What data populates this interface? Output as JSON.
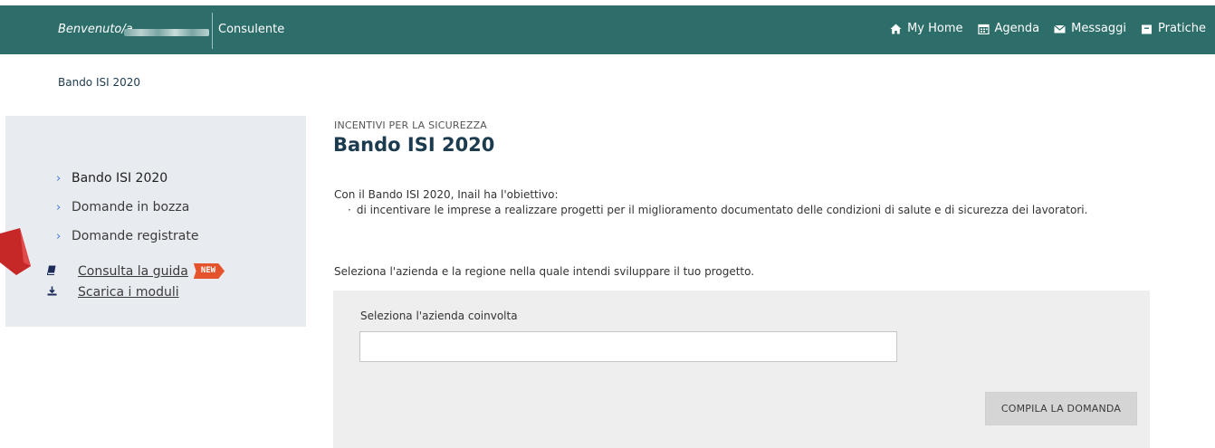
{
  "header": {
    "welcome": "Benvenuto/a",
    "role": "Consulente",
    "nav": [
      {
        "label": "My Home",
        "icon": "home-icon"
      },
      {
        "label": "Agenda",
        "icon": "calendar-icon"
      },
      {
        "label": "Messaggi",
        "icon": "envelope-icon"
      },
      {
        "label": "Pratiche",
        "icon": "folder-icon"
      }
    ]
  },
  "breadcrumb": "Bando ISI 2020",
  "sidebar": {
    "items": [
      {
        "label": "Bando ISI 2020",
        "active": true
      },
      {
        "label": "Domande in bozza",
        "active": false
      },
      {
        "label": "Domande registrate",
        "active": false
      }
    ],
    "links": [
      {
        "label": "Consulta la guida",
        "icon": "book-icon",
        "badge": "NEW"
      },
      {
        "label": "Scarica i moduli",
        "icon": "download-icon"
      }
    ]
  },
  "main": {
    "kicker": "INCENTIVI PER LA SICUREZZA",
    "title": "Bando ISI 2020",
    "intro": "Con il Bando ISI 2020, Inail ha l'obiettivo:",
    "bullet": "di incentivare le imprese a realizzare progetti per il miglioramento documentato delle condizioni di salute e di sicurezza dei lavoratori.",
    "instruction": "Seleziona l'azienda e la regione nella quale intendi sviluppare il tuo progetto.",
    "form": {
      "field_label": "Seleziona l'azienda coinvolta",
      "field_value": "",
      "submit_label": "COMPILA LA DOMANDA"
    }
  },
  "colors": {
    "header_bg": "#2d6e6a",
    "sidebar_bg": "#e8ecf0",
    "panel_bg": "#eeeeee",
    "accent_blue": "#3d7bd6",
    "badge": "#e5532d",
    "arrow": "#c62828"
  }
}
